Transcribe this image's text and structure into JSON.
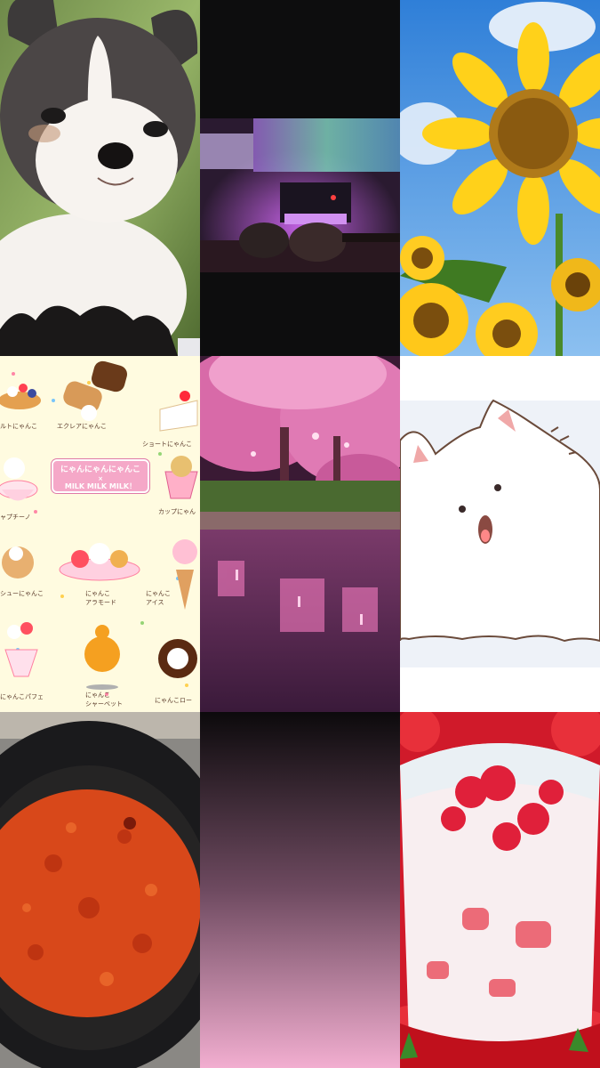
{
  "collage": {
    "tiles": [
      {
        "id": "chihuahua-photo",
        "subject": "Chihuahua puppy"
      },
      {
        "id": "karaoke-photo",
        "subject": "Microphones in karaoke room"
      },
      {
        "id": "sunflower-photo",
        "subject": "Sunflowers under blue sky"
      },
      {
        "id": "nyanko-sweets-illustration",
        "subject": "Cat sweets illustration"
      },
      {
        "id": "night-sakura-photo",
        "subject": "Night cherry blossoms over river"
      },
      {
        "id": "cat-ghost-illustration",
        "subject": "White cat illustration"
      },
      {
        "id": "tomato-stew-photo",
        "subject": "Tomato stew in bowl"
      },
      {
        "id": "gradient-tile",
        "subject": "Black to pink gradient"
      },
      {
        "id": "strawberry-milk-photo",
        "subject": "Strawberry milk drink"
      }
    ]
  },
  "sweets": {
    "banner_line1": "にゃんにゃんにゃんこ",
    "banner_line2": "×",
    "banner_line3": "MILK MILK MILK！",
    "captions": [
      "ルトにゃんこ",
      "エクレアにゃんこ",
      "ショートにゃんこ",
      "ャプチーノ",
      "カップにゃん",
      "シューにゃんこ",
      "にゃんこ",
      "アラモード",
      "にゃんこ",
      "アイス",
      "にゃんこパフェ",
      "にゃんこ",
      "シャーベット",
      "にゃんこロー"
    ]
  }
}
